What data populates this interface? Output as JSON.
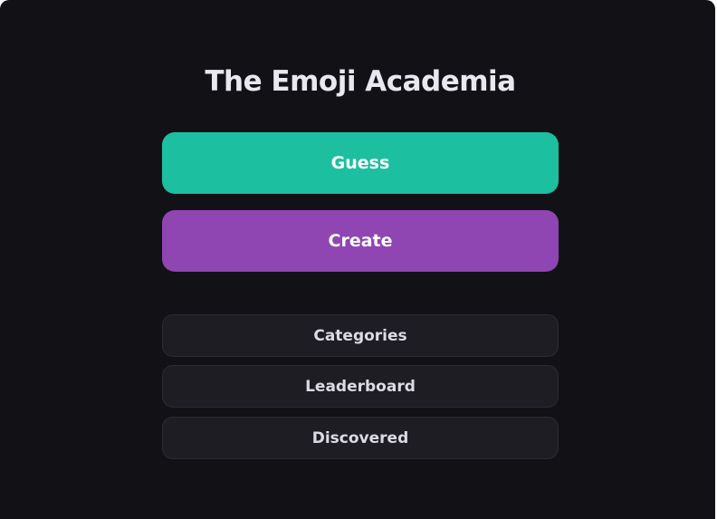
{
  "app": {
    "title": "The Emoji Academia"
  },
  "primary_actions": {
    "guess_label": "Guess",
    "create_label": "Create"
  },
  "secondary_actions": {
    "categories_label": "Categories",
    "leaderboard_label": "Leaderboard",
    "discovered_label": "Discovered"
  },
  "colors": {
    "background": "#121116",
    "guess_button": "#1cbf9f",
    "create_button": "#8f45b2",
    "secondary_button": "#1e1d23",
    "title_text": "#e9e7ef"
  }
}
